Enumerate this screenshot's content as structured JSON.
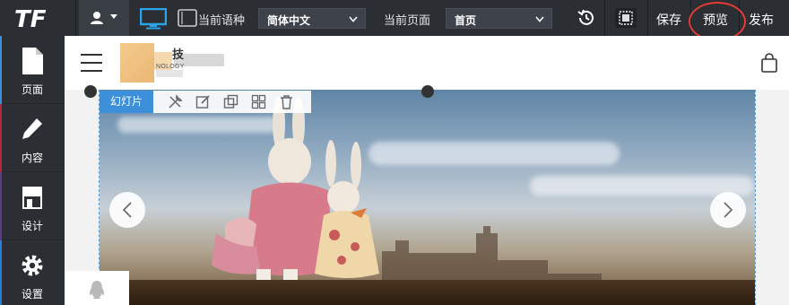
{
  "topbar": {
    "logo": "TF",
    "language_label": "当前语种",
    "language_value": "简体中文",
    "page_label": "当前页面",
    "page_value": "首页",
    "save_label": "保存",
    "preview_label": "预览",
    "publish_label": "发布"
  },
  "sidebar": {
    "items": [
      {
        "label": "页面",
        "icon": "page-icon",
        "accent": "#3d8fd9"
      },
      {
        "label": "内容",
        "icon": "pencil-icon",
        "accent": "#b3263d"
      },
      {
        "label": "设计",
        "icon": "store-icon",
        "accent": "#5a3b8c"
      },
      {
        "label": "设置",
        "icon": "gear-icon",
        "accent": "#2a7fd4"
      }
    ]
  },
  "site": {
    "brand_text": "技",
    "brand_sub": "NOLOGY"
  },
  "slider_tag": "幻灯片",
  "colors": {
    "toolbar_bg": "#2b2e33",
    "accent_blue": "#3d8fd9",
    "highlight_red": "#e53935"
  }
}
